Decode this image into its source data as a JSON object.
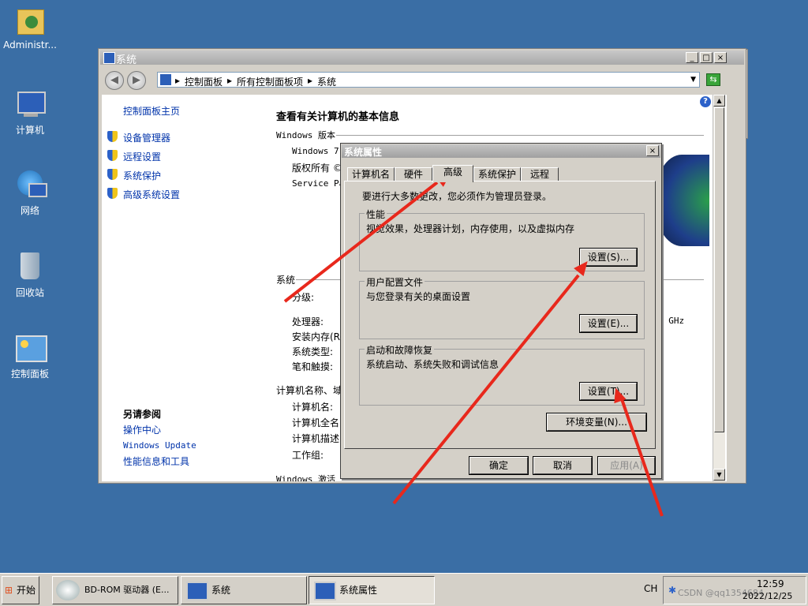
{
  "desktop": {
    "icons": [
      {
        "label": "Administr..."
      },
      {
        "label": "计算机"
      },
      {
        "label": "网络"
      },
      {
        "label": "回收站"
      },
      {
        "label": "控制面板"
      }
    ]
  },
  "system_window": {
    "title": "系统",
    "buttons": {
      "minimize": "_",
      "maximize": "□",
      "close": "×"
    },
    "breadcrumb": [
      "控制面板",
      "所有控制面板项",
      "系统"
    ],
    "left_panel": {
      "home": "控制面板主页",
      "links": [
        "设备管理器",
        "远程设置",
        "系统保护",
        "高级系统设置"
      ],
      "see_also_title": "另请参阅",
      "see_also": [
        "操作中心",
        "Windows Update",
        "性能信息和工具"
      ]
    },
    "main": {
      "heading": "查看有关计算机的基本信息",
      "edition_header": "Windows 版本",
      "edition_lines": [
        "Windows 7",
        "版权所有 ©",
        "Service Pa"
      ],
      "system_header": "系统",
      "system_rows": [
        "分级:",
        "处理器:",
        "安装内存(R",
        "系统类型:",
        "笔和触摸:"
      ],
      "ghz": "0 GHz",
      "computer_header": "计算机名称、域",
      "computer_rows": [
        "计算机名:",
        "计算机全名",
        "计算机描述",
        "工作组:"
      ],
      "activation_header": "Windows 激活"
    }
  },
  "dialog": {
    "title": "系统属性",
    "close": "×",
    "tabs": [
      "计算机名",
      "硬件",
      "高级",
      "系统保护",
      "远程"
    ],
    "active_tab": "高级",
    "admin_note": "要进行大多数更改，您必须作为管理员登录。",
    "groups": [
      {
        "title": "性能",
        "desc": "视觉效果，处理器计划，内存使用，以及虚拟内存",
        "button": "设置(S)..."
      },
      {
        "title": "用户配置文件",
        "desc": "与您登录有关的桌面设置",
        "button": "设置(E)..."
      },
      {
        "title": "启动和故障恢复",
        "desc": "系统启动、系统失败和调试信息",
        "button": "设置(T)..."
      }
    ],
    "env_button": "环境变量(N)...",
    "ok": "确定",
    "cancel": "取消",
    "apply": "应用(A)"
  },
  "taskbar": {
    "start": "开始",
    "items": [
      {
        "label": "BD-ROM 驱动器 (E..."
      },
      {
        "label": "系统"
      },
      {
        "label": "系统属性"
      }
    ],
    "lang": "CH",
    "time": "12:59",
    "date": "2022/12/25",
    "watermark": "CSDN @qq1354684"
  },
  "colors": {
    "arrow": "#e8281c",
    "desktop": "#3a6ea5",
    "link": "#0033aa"
  }
}
